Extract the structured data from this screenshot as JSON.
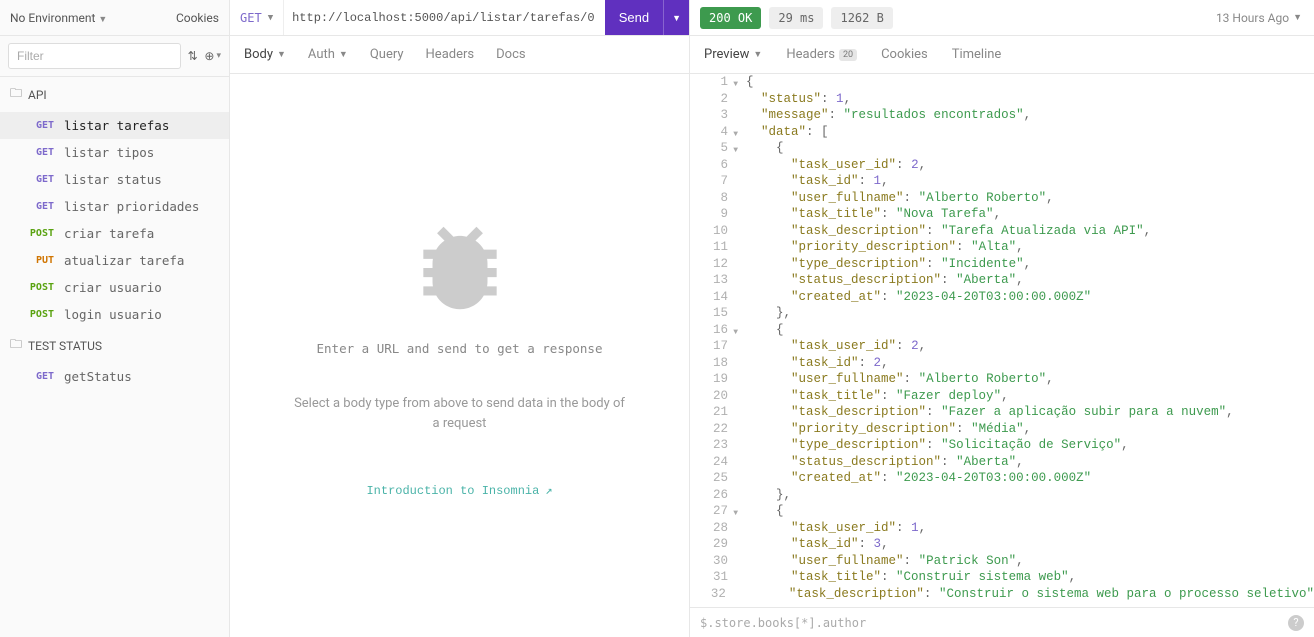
{
  "sidebar": {
    "env_label": "No Environment",
    "cookies_label": "Cookies",
    "filter_placeholder": "Filter",
    "folders": [
      {
        "name": "API",
        "items": [
          {
            "method": "GET",
            "method_class": "m-get",
            "label": "listar tarefas",
            "active": true
          },
          {
            "method": "GET",
            "method_class": "m-get",
            "label": "listar tipos"
          },
          {
            "method": "GET",
            "method_class": "m-get",
            "label": "listar status"
          },
          {
            "method": "GET",
            "method_class": "m-get",
            "label": "listar prioridades"
          },
          {
            "method": "POST",
            "method_class": "m-post",
            "label": "criar tarefa"
          },
          {
            "method": "PUT",
            "method_class": "m-put",
            "label": "atualizar tarefa"
          },
          {
            "method": "POST",
            "method_class": "m-post",
            "label": "criar usuario"
          },
          {
            "method": "POST",
            "method_class": "m-post",
            "label": "login usuario"
          }
        ]
      },
      {
        "name": "TEST STATUS",
        "items": [
          {
            "method": "GET",
            "method_class": "m-get",
            "label": "getStatus"
          }
        ]
      }
    ]
  },
  "request": {
    "method": "GET",
    "url": "http://localhost:5000/api/listar/tarefas/0",
    "send_label": "Send",
    "tabs": [
      "Body",
      "Auth",
      "Query",
      "Headers",
      "Docs"
    ],
    "empty_line1": "Enter a URL and send to get a response",
    "empty_line2": "Select a body type from above to send data in the body of a request",
    "intro_link": "Introduction to Insomnia"
  },
  "response": {
    "status_pill": "200 OK",
    "time_pill": "29 ms",
    "size_pill": "1262 B",
    "history": "13 Hours Ago",
    "tabs": {
      "preview": "Preview",
      "headers": "Headers",
      "headers_badge": "20",
      "cookies": "Cookies",
      "timeline": "Timeline"
    },
    "footer_placeholder": "$.store.books[*].author",
    "code_lines": [
      {
        "n": 1,
        "fold": true,
        "indent": 0,
        "raw": "{"
      },
      {
        "n": 2,
        "indent": 1,
        "key": "status",
        "num": "1",
        "comma": true
      },
      {
        "n": 3,
        "indent": 1,
        "key": "message",
        "str": "resultados encontrados",
        "comma": true
      },
      {
        "n": 4,
        "fold": true,
        "indent": 1,
        "key": "data",
        "raw_after_colon": "["
      },
      {
        "n": 5,
        "fold": true,
        "indent": 2,
        "raw": "{"
      },
      {
        "n": 6,
        "indent": 3,
        "key": "task_user_id",
        "num": "2",
        "comma": true
      },
      {
        "n": 7,
        "indent": 3,
        "key": "task_id",
        "num": "1",
        "comma": true
      },
      {
        "n": 8,
        "indent": 3,
        "key": "user_fullname",
        "str": "Alberto Roberto",
        "comma": true
      },
      {
        "n": 9,
        "indent": 3,
        "key": "task_title",
        "str": "Nova Tarefa",
        "comma": true
      },
      {
        "n": 10,
        "indent": 3,
        "key": "task_description",
        "str": "Tarefa Atualizada via API",
        "comma": true
      },
      {
        "n": 11,
        "indent": 3,
        "key": "priority_description",
        "str": "Alta",
        "comma": true
      },
      {
        "n": 12,
        "indent": 3,
        "key": "type_description",
        "str": "Incidente",
        "comma": true
      },
      {
        "n": 13,
        "indent": 3,
        "key": "status_description",
        "str": "Aberta",
        "comma": true
      },
      {
        "n": 14,
        "indent": 3,
        "key": "created_at",
        "str": "2023-04-20T03:00:00.000Z"
      },
      {
        "n": 15,
        "indent": 2,
        "raw": "},"
      },
      {
        "n": 16,
        "fold": true,
        "indent": 2,
        "raw": "{"
      },
      {
        "n": 17,
        "indent": 3,
        "key": "task_user_id",
        "num": "2",
        "comma": true
      },
      {
        "n": 18,
        "indent": 3,
        "key": "task_id",
        "num": "2",
        "comma": true
      },
      {
        "n": 19,
        "indent": 3,
        "key": "user_fullname",
        "str": "Alberto Roberto",
        "comma": true
      },
      {
        "n": 20,
        "indent": 3,
        "key": "task_title",
        "str": "Fazer deploy",
        "comma": true
      },
      {
        "n": 21,
        "indent": 3,
        "key": "task_description",
        "str": "Fazer a aplicação subir para a nuvem",
        "comma": true
      },
      {
        "n": 22,
        "indent": 3,
        "key": "priority_description",
        "str": "Média",
        "comma": true
      },
      {
        "n": 23,
        "indent": 3,
        "key": "type_description",
        "str": "Solicitação de Serviço",
        "comma": true
      },
      {
        "n": 24,
        "indent": 3,
        "key": "status_description",
        "str": "Aberta",
        "comma": true
      },
      {
        "n": 25,
        "indent": 3,
        "key": "created_at",
        "str": "2023-04-20T03:00:00.000Z"
      },
      {
        "n": 26,
        "indent": 2,
        "raw": "},"
      },
      {
        "n": 27,
        "fold": true,
        "indent": 2,
        "raw": "{"
      },
      {
        "n": 28,
        "indent": 3,
        "key": "task_user_id",
        "num": "1",
        "comma": true
      },
      {
        "n": 29,
        "indent": 3,
        "key": "task_id",
        "num": "3",
        "comma": true
      },
      {
        "n": 30,
        "indent": 3,
        "key": "user_fullname",
        "str": "Patrick Son",
        "comma": true
      },
      {
        "n": 31,
        "indent": 3,
        "key": "task_title",
        "str": "Construir sistema web",
        "comma": true
      },
      {
        "n": 32,
        "indent": 3,
        "key": "task_description",
        "str": "Construir o sistema web para o processo seletivo"
      }
    ]
  }
}
